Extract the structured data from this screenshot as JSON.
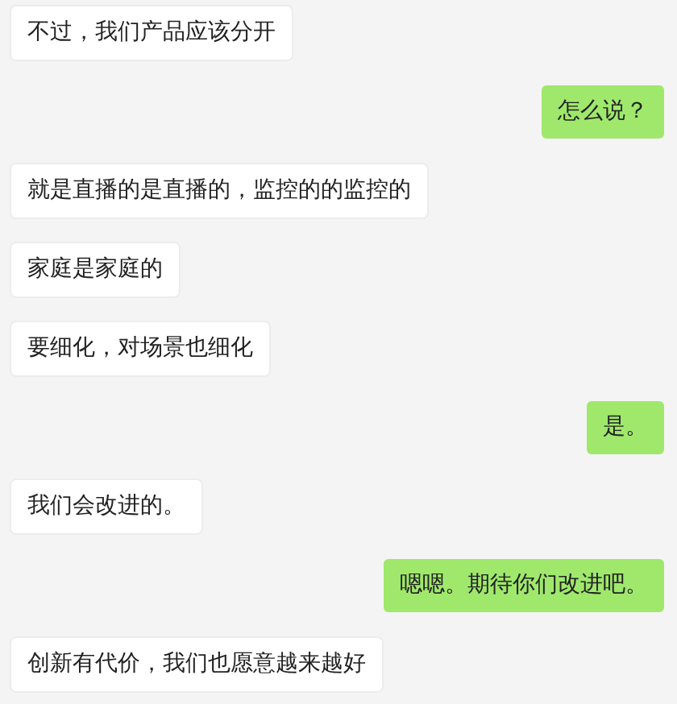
{
  "messages": [
    {
      "kind": "received",
      "text": "不过，我们产品应该分开"
    },
    {
      "kind": "sent",
      "text": "怎么说？"
    },
    {
      "kind": "received",
      "text": "就是直播的是直播的，监控的的监控的"
    },
    {
      "kind": "received",
      "text": "家庭是家庭的"
    },
    {
      "kind": "received",
      "text": "要细化，对场景也细化"
    },
    {
      "kind": "sent",
      "text": "是。"
    },
    {
      "kind": "received",
      "text": "我们会改进的。"
    },
    {
      "kind": "sent",
      "text": "嗯嗯。期待你们改进吧。"
    },
    {
      "kind": "received",
      "text": "创新有代价，我们也愿意越来越好"
    }
  ]
}
